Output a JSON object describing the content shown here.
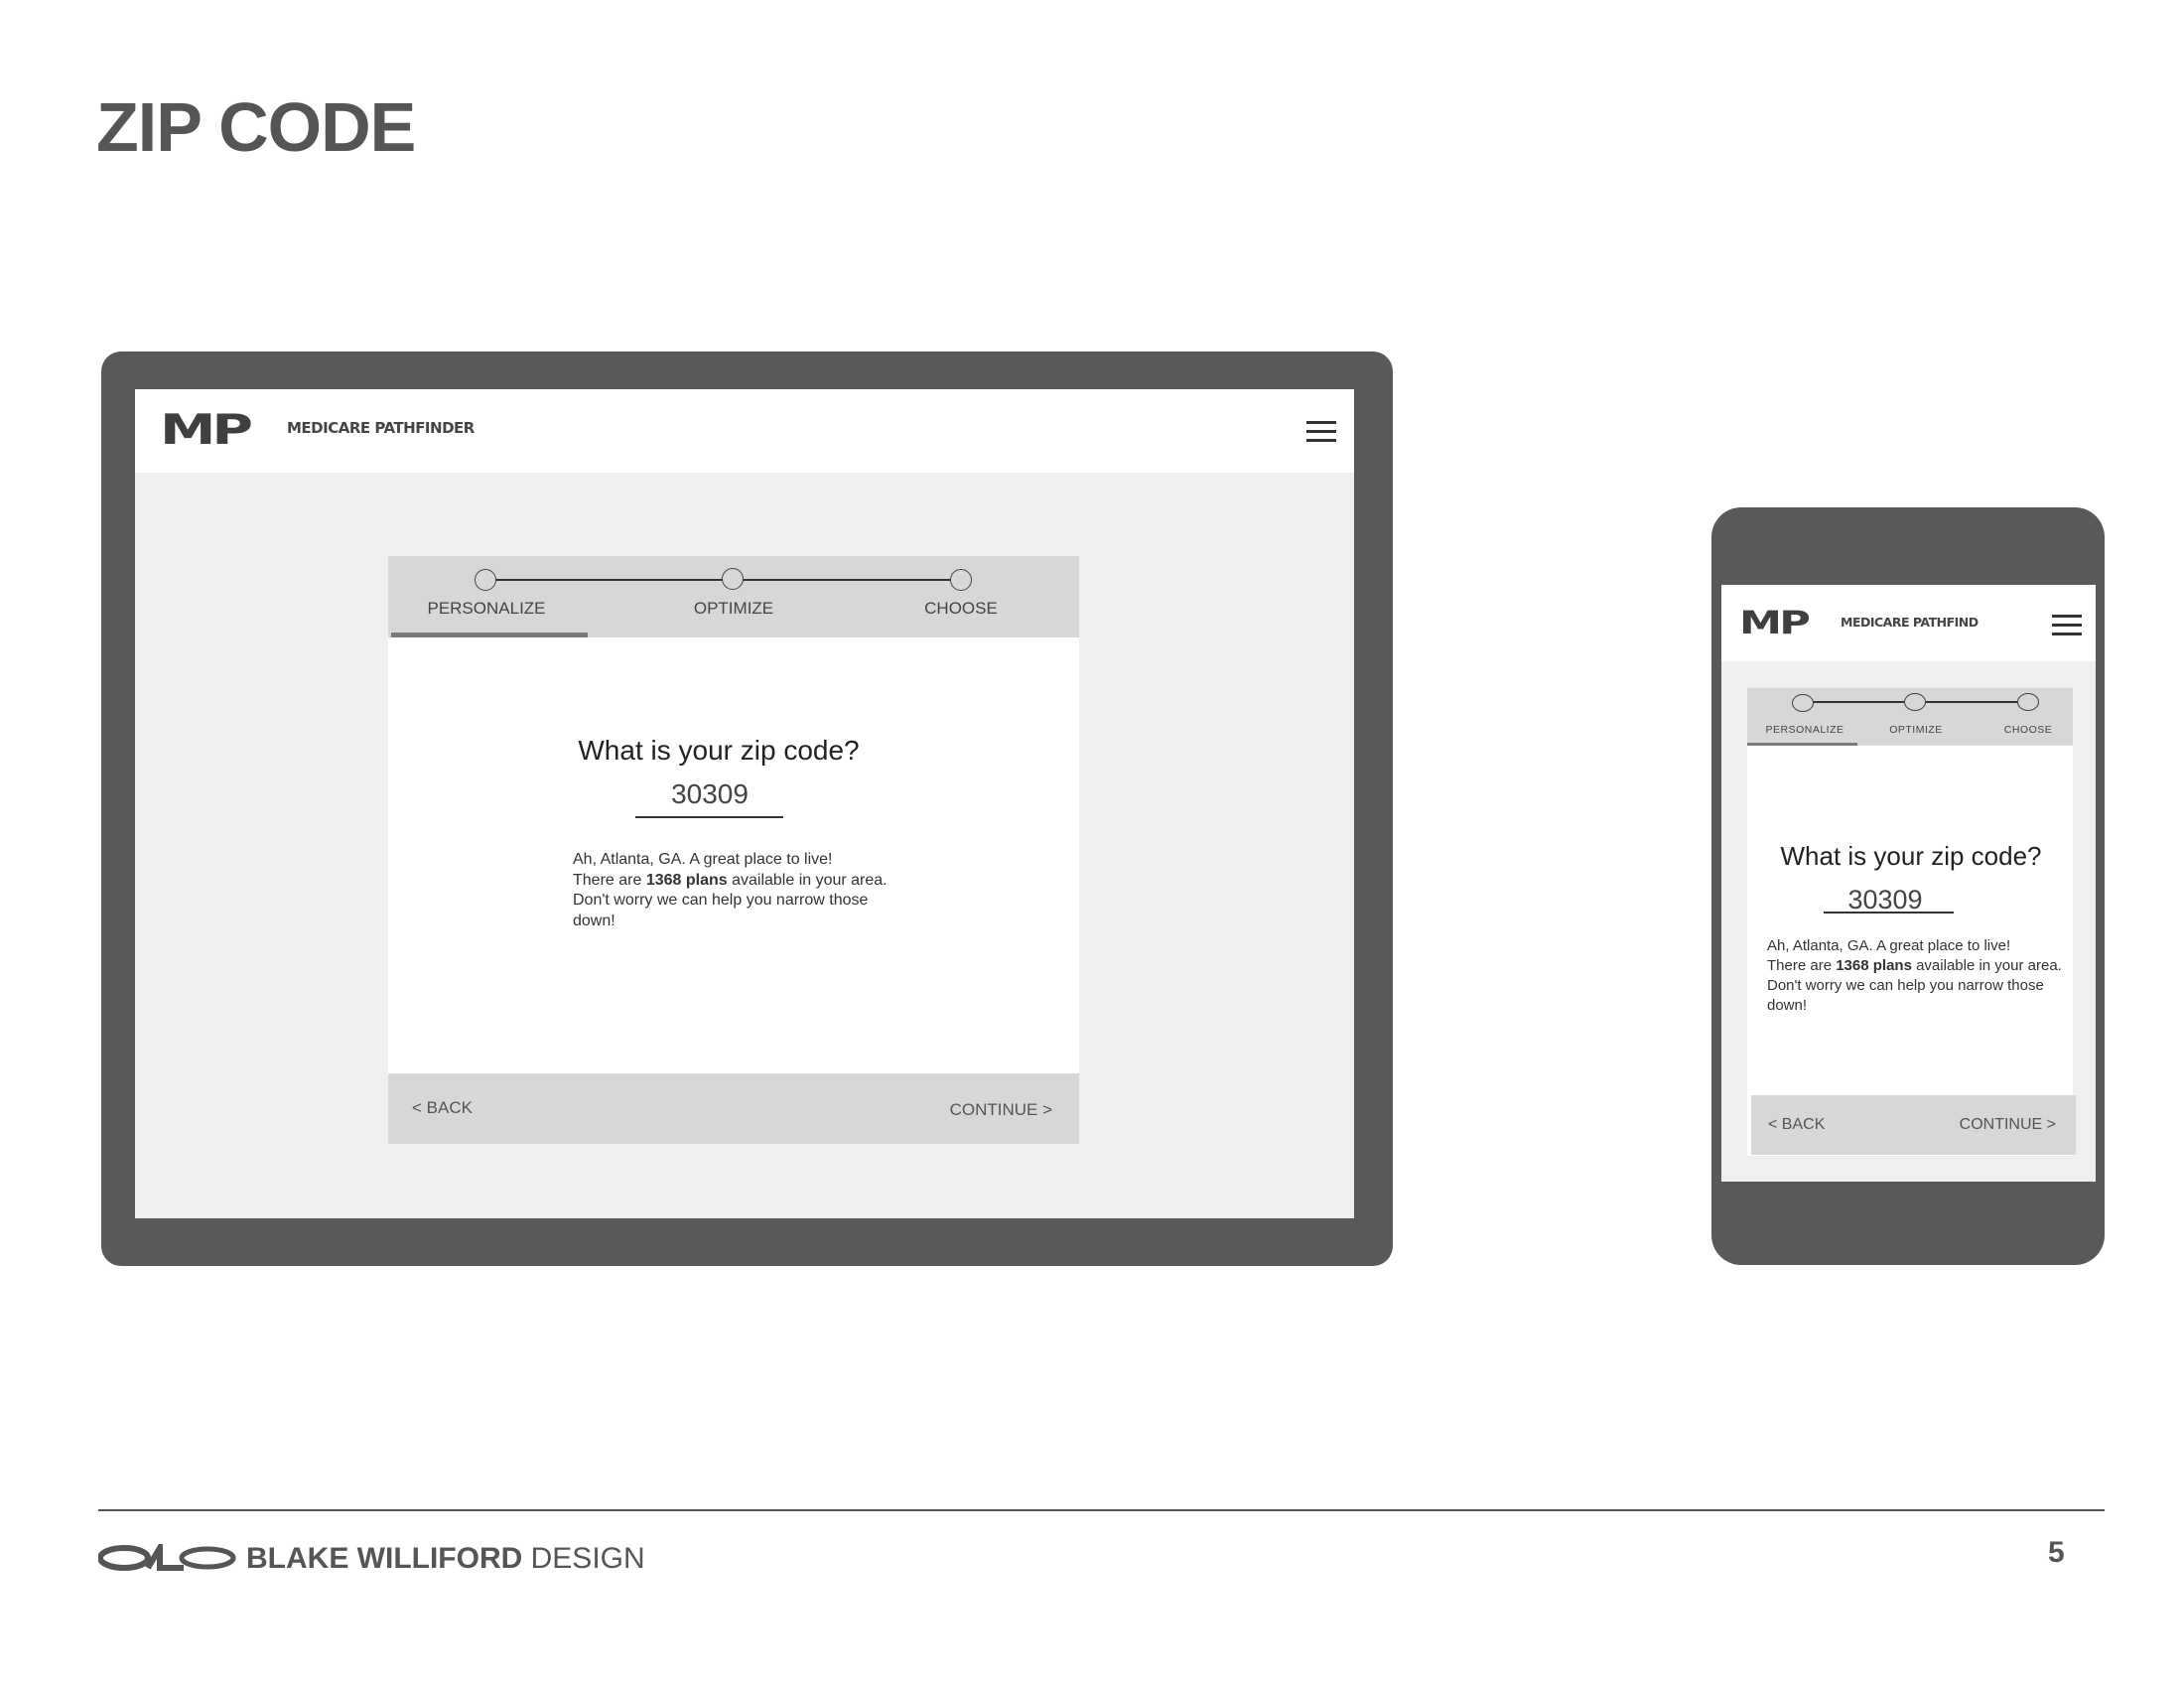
{
  "page_title": "ZIP CODE",
  "app": {
    "logo_mark": "MP",
    "brand_desktop": "MEDICARE PATHFINDER",
    "brand_mobile": "MEDICARE PATHFIND"
  },
  "stepper": {
    "steps": [
      {
        "label": "PERSONALIZE",
        "active": true
      },
      {
        "label": "OPTIMIZE",
        "active": false
      },
      {
        "label": "CHOOSE",
        "active": false
      }
    ]
  },
  "form": {
    "question": "What is your zip code?",
    "zip_value": "30309",
    "message_line1": "Ah, Atlanta, GA.  A great place to live!",
    "message_pre": "There are ",
    "message_bold": "1368 plans",
    "message_post": " available in your area.  Don't worry we can help you narrow those down!"
  },
  "nav": {
    "back": "< BACK",
    "continue": "CONTINUE >"
  },
  "footer": {
    "logo_mark": "BW",
    "brand_bold": "BLAKE WILLIFORD",
    "brand_light": " DESIGN",
    "page_number": "5"
  },
  "colors": {
    "frame": "#58595b",
    "screen": "#eeeff0",
    "band": "#d7d7d5",
    "progress": "#7a7a7a"
  }
}
